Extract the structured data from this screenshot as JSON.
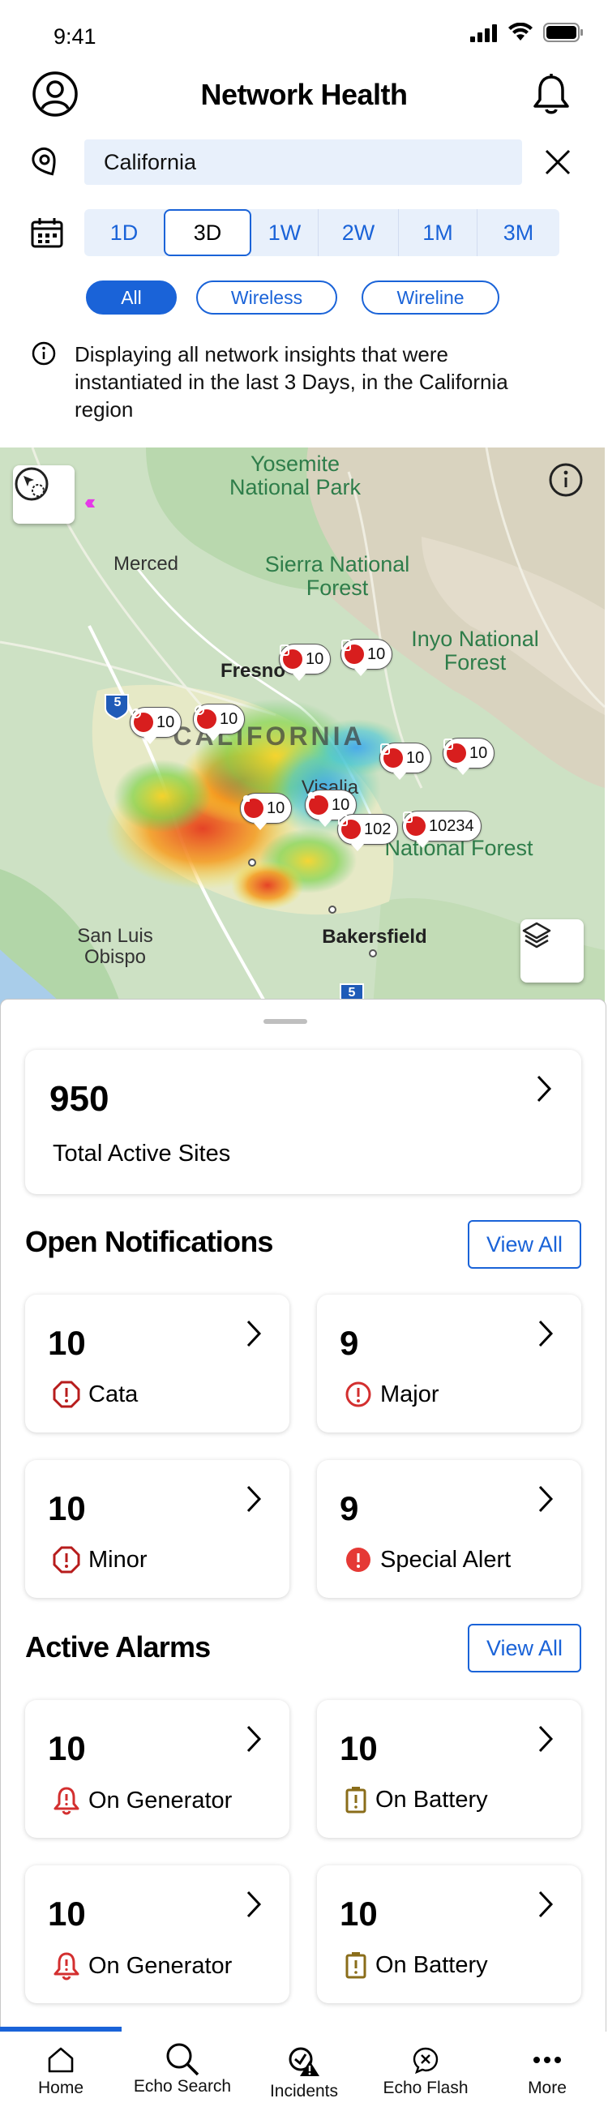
{
  "status": {
    "time": "9:41"
  },
  "header": {
    "title": "Network Health"
  },
  "region": {
    "value": "California"
  },
  "range": {
    "options": [
      "1D",
      "3D",
      "1W",
      "2W",
      "1M",
      "3M"
    ],
    "selected": "3D"
  },
  "chips": {
    "options": [
      "All",
      "Wireless",
      "Wireline"
    ],
    "selected": "All"
  },
  "info": {
    "text": "Displaying all network insights that were instantiated in the last 3 Days, in the California region"
  },
  "map": {
    "labels": {
      "yosemite": "Yosemite National Park",
      "sierra": "Sierra National Forest",
      "inyo": "Inyo National Forest",
      "merced": "Merced",
      "fresno": "Fresno",
      "california": "CALIFORNIA",
      "visalia": "Visalia",
      "sequoia_forest": "National Forest",
      "san_luis": "San Luis Obispo",
      "bakersfield": "Bakersfield",
      "hwy5_top": "5",
      "hwy5_bottom": "5"
    },
    "pins": [
      "10",
      "10",
      "10",
      "10",
      "10",
      "10",
      "10",
      "10",
      "102",
      "10234"
    ]
  },
  "summary": {
    "total_value": "950",
    "total_label": "Total Active Sites"
  },
  "notifications": {
    "title": "Open Notifications",
    "view_all": "View All",
    "items": [
      {
        "value": "10",
        "label": "Cata",
        "icon": "octagon-alert-icon",
        "color": "#b71c1c"
      },
      {
        "value": "9",
        "label": "Major",
        "icon": "circle-alert-icon",
        "color": "#d32f2f"
      },
      {
        "value": "10",
        "label": "Minor",
        "icon": "octagon-alert-icon",
        "color": "#b71c1c"
      },
      {
        "value": "9",
        "label": "Special Alert",
        "icon": "filled-circle-alert-icon",
        "color": "#e53935"
      }
    ]
  },
  "alarms": {
    "title": "Active Alarms",
    "view_all": "View All",
    "items": [
      {
        "value": "10",
        "label": "On Generator",
        "icon": "bell-alert-icon",
        "color": "#d32f2f"
      },
      {
        "value": "10",
        "label": "On Battery",
        "icon": "battery-alert-icon",
        "color": "#8a6d1a"
      },
      {
        "value": "10",
        "label": "On Generator",
        "icon": "bell-alert-icon",
        "color": "#d32f2f"
      },
      {
        "value": "10",
        "label": "On Battery",
        "icon": "battery-alert-icon",
        "color": "#8a6d1a"
      }
    ]
  },
  "tabs": [
    {
      "label": "Home",
      "icon": "home-icon"
    },
    {
      "label": "Echo Search",
      "icon": "search-icon"
    },
    {
      "label": "Incidents",
      "icon": "incidents-icon"
    },
    {
      "label": "Echo Flash",
      "icon": "flash-icon"
    },
    {
      "label": "More",
      "icon": "more-icon"
    }
  ],
  "colors": {
    "accent": "#1a63d8",
    "alert": "#d81e1e"
  }
}
